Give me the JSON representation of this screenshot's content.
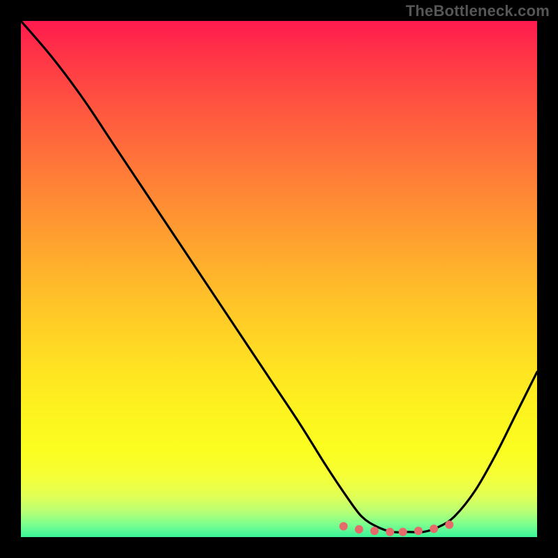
{
  "attribution": "TheBottleneck.com",
  "chart_data": {
    "type": "line",
    "title": "",
    "xlabel": "",
    "ylabel": "",
    "xlim": [
      0,
      100
    ],
    "ylim": [
      0,
      100
    ],
    "series": [
      {
        "name": "curve",
        "x": [
          0,
          6,
          12,
          18,
          24,
          30,
          36,
          42,
          48,
          54,
          59,
          63,
          66,
          69,
          72,
          75,
          78,
          81,
          84,
          88,
          92,
          96,
          100
        ],
        "y": [
          100,
          93,
          85,
          76,
          67,
          58,
          49,
          40,
          31,
          22,
          14,
          8,
          4,
          2,
          1,
          1,
          1,
          2,
          4,
          9,
          16,
          24,
          32
        ]
      }
    ],
    "markers": {
      "name": "highlight-dots",
      "x": [
        62.5,
        65.5,
        68.5,
        71.5,
        74,
        77,
        80,
        83
      ],
      "y": [
        2.1,
        1.5,
        1.2,
        1.0,
        1.0,
        1.2,
        1.6,
        2.4
      ],
      "color": "#e66a6a",
      "radius_px": 6
    },
    "gradient_stops": [
      {
        "pos": 0.0,
        "color": "#ff1a4e"
      },
      {
        "pos": 0.17,
        "color": "#ff5640"
      },
      {
        "pos": 0.42,
        "color": "#ffa030"
      },
      {
        "pos": 0.67,
        "color": "#ffe222"
      },
      {
        "pos": 0.88,
        "color": "#f6ff35"
      },
      {
        "pos": 1.0,
        "color": "#39f59a"
      }
    ]
  }
}
